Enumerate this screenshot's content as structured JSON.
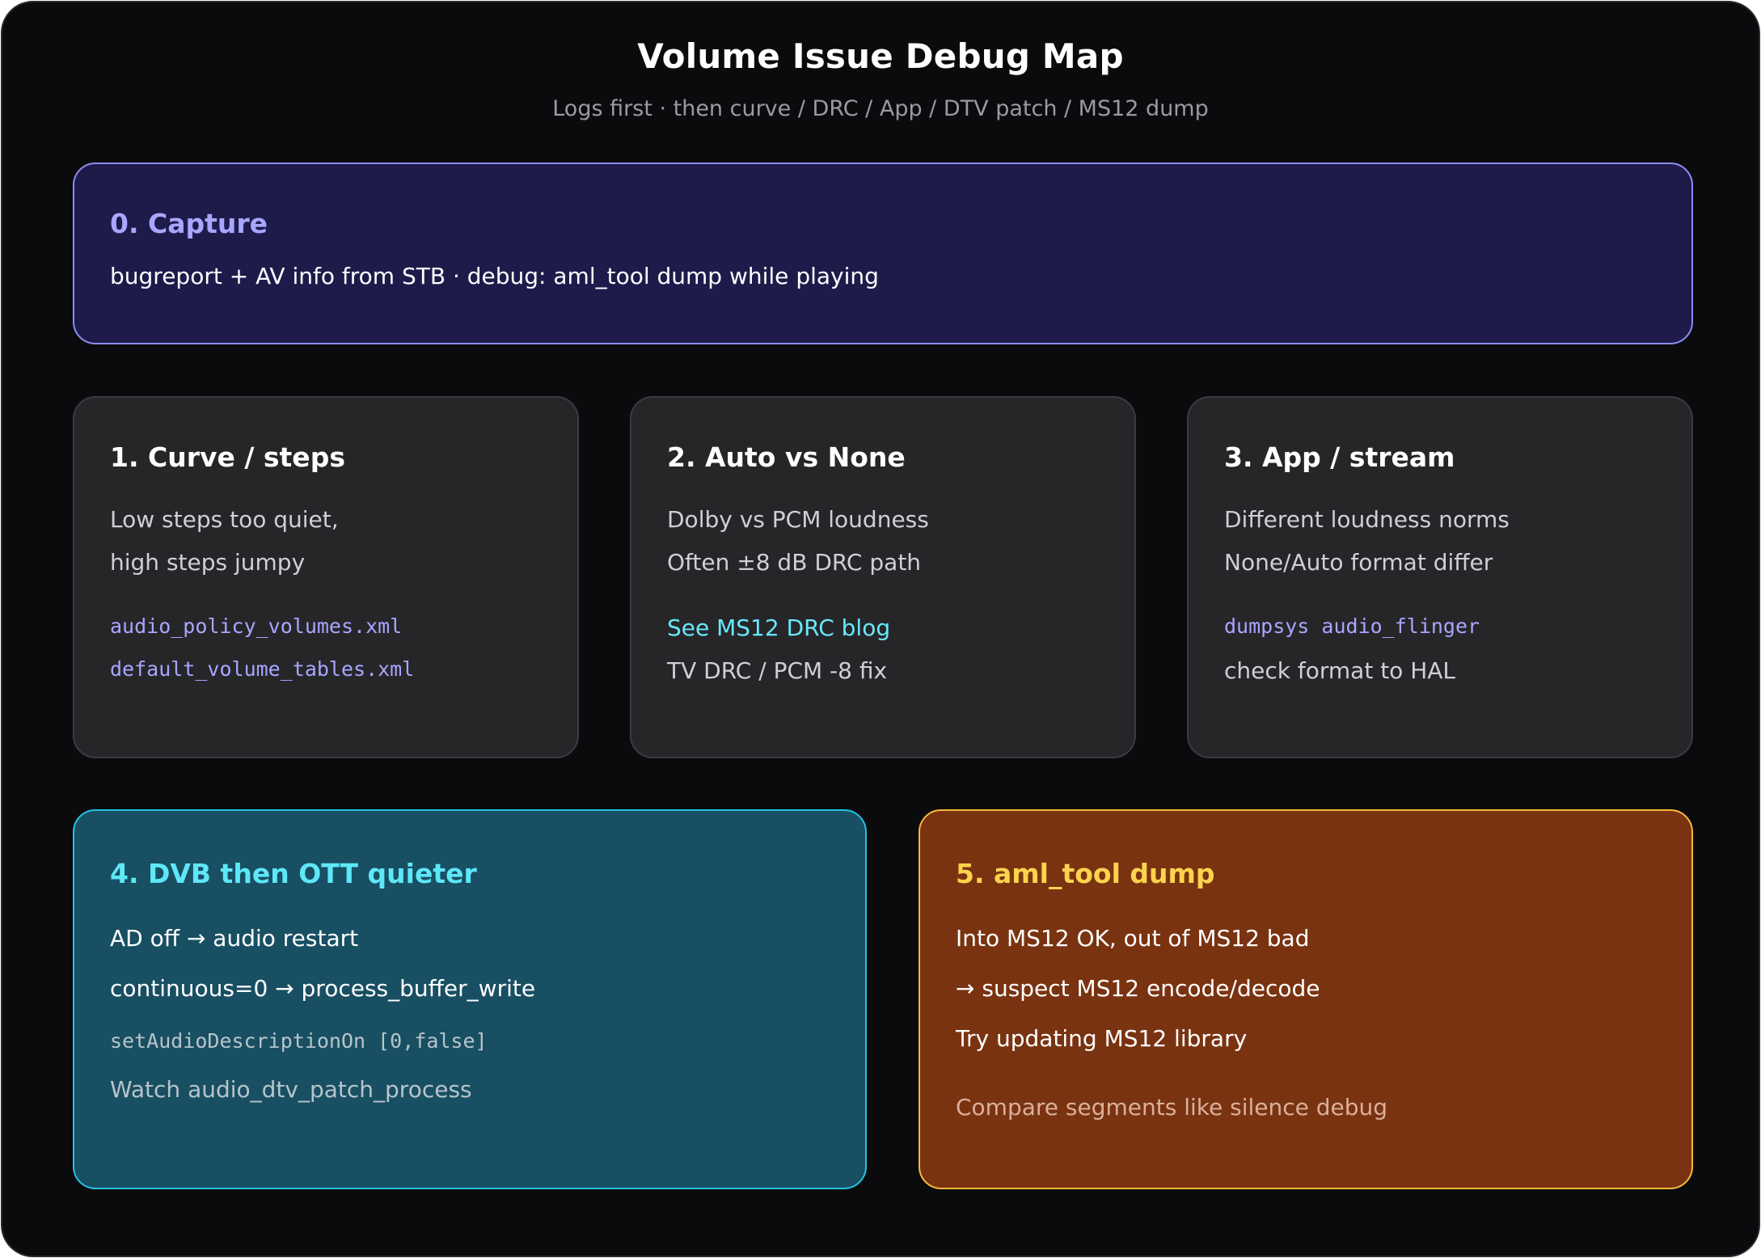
{
  "header": {
    "title": "Volume Issue Debug Map",
    "subtitle": "Logs first · then curve / DRC / App / DTV patch / MS12 dump"
  },
  "cards": {
    "capture": {
      "heading": "0. Capture",
      "lines": [
        "bugreport + AV info from STB · debug: aml_tool dump while playing"
      ]
    },
    "curve": {
      "heading": "1. Curve / steps",
      "lines": [
        "Low steps too quiet,",
        "high steps jumpy",
        "audio_policy_volumes.xml",
        "default_volume_tables.xml"
      ]
    },
    "auto_none": {
      "heading": "2. Auto vs None",
      "lines": [
        "Dolby vs PCM loudness",
        "Often ±8 dB DRC path",
        "See MS12 DRC blog",
        "TV DRC / PCM -8 fix"
      ]
    },
    "app_stream": {
      "heading": "3. App / stream",
      "lines": [
        "Different loudness norms",
        "None/Auto format differ",
        "dumpsys audio_flinger",
        "check format to HAL"
      ]
    },
    "dvb_ott": {
      "heading": "4. DVB then OTT quieter",
      "lines": [
        "AD off → audio restart",
        "continuous=0 → process_buffer_write",
        "setAudioDescriptionOn [0,false]",
        "Watch audio_dtv_patch_process"
      ]
    },
    "aml_tool": {
      "heading": "5. aml_tool dump",
      "lines": [
        "Into MS12 OK, out of MS12 bad",
        "→ suspect MS12 encode/decode",
        "Try updating MS12 library",
        "Compare segments like silence debug"
      ]
    }
  },
  "colors": {
    "background": "#0b0b0e",
    "capture_fill": "#1e1b4b",
    "capture_border": "#8d8cf0",
    "neutral_fill": "#262629",
    "dvb_fill": "#184f63",
    "dvb_border": "#22c3e0",
    "aml_fill": "#7a3311",
    "aml_border": "#f6b83a",
    "link": "#67e8f9",
    "code": "#a8a6ff"
  }
}
